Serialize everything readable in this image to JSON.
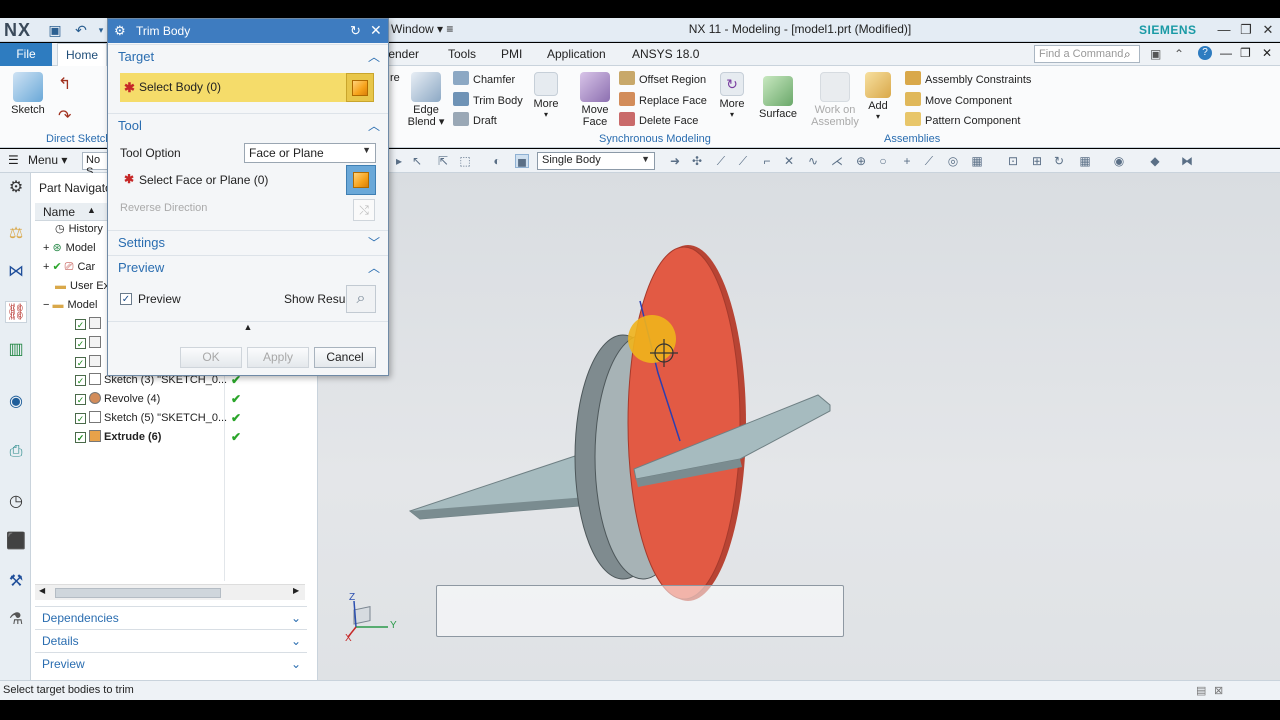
{
  "app": {
    "logo": "NX",
    "window_menu": "Window ▾ ≡",
    "title": "NX 11 - Modeling - [model1.prt (Modified)]",
    "brand": "SIEMENS"
  },
  "tabs": [
    {
      "label": "File"
    },
    {
      "label": "Home"
    },
    {
      "label": "tender"
    },
    {
      "label": "Tools"
    },
    {
      "label": "PMI"
    },
    {
      "label": "Application"
    },
    {
      "label": "ANSYS 18.0"
    }
  ],
  "search": {
    "placeholder": "Find a Command"
  },
  "ribbon": {
    "sketch_label": "Sketch",
    "direct_sketch_label": "Direct Sketch",
    "re_label": "re",
    "edge_blend_label": "Edge\nBlend ▾",
    "chamfer_label": "Chamfer",
    "trim_body_label": "Trim Body",
    "draft_label": "Draft",
    "more_label": "More",
    "move_face_label": "Move\nFace",
    "offset_region_label": "Offset Region",
    "replace_face_label": "Replace Face",
    "delete_face_label": "Delete Face",
    "sync_modeling_label": "Synchronous Modeling",
    "more2_label": "More",
    "surface_label": "Surface",
    "work_on_assembly_label": "Work on\nAssembly",
    "add_label": "Add",
    "assembly_constraints_label": "Assembly Constraints",
    "move_component_label": "Move Component",
    "pattern_component_label": "Pattern Component",
    "assemblies_label": "Assemblies"
  },
  "cmdbar": {
    "menu_label": "Menu ▾",
    "filter_value": "No S",
    "single_body_value": "Single Body"
  },
  "part_navigator": {
    "title": "Part Navigato",
    "col_name": "Name",
    "rows": [
      {
        "label": "History"
      },
      {
        "label": "Model"
      },
      {
        "label": "Car"
      },
      {
        "label": "User Ex"
      },
      {
        "label": "Model"
      },
      {
        "label": ""
      },
      {
        "label": ""
      },
      {
        "label": ""
      },
      {
        "label": "Sketch (3) \"SKETCH_0..."
      },
      {
        "label": "Revolve (4)"
      },
      {
        "label": "Sketch (5) \"SKETCH_0..."
      },
      {
        "label": "Extrude (6)"
      }
    ],
    "panels": {
      "dependencies": "Dependencies",
      "details": "Details",
      "preview": "Preview"
    }
  },
  "dialog": {
    "title": "Trim Body",
    "target_section": "Target",
    "select_body": "Select Body (0)",
    "tool_section": "Tool",
    "tool_option_label": "Tool Option",
    "tool_option_value": "Face or Plane",
    "select_face": "Select Face or Plane (0)",
    "reverse_direction": "Reverse Direction",
    "settings_section": "Settings",
    "preview_section": "Preview",
    "preview_checkbox": "Preview",
    "show_result": "Show Result",
    "ok": "OK",
    "apply": "Apply",
    "cancel": "Cancel"
  },
  "triad": {
    "x": "X",
    "y": "Y",
    "z": "Z"
  },
  "status": {
    "text": "Select target bodies to trim"
  },
  "colors": {
    "accent": "#3e7cc0",
    "target_highlight": "#f5dc6a",
    "trim_tool_red": "#e25a44",
    "sheet_body": "#a8bcc0"
  }
}
